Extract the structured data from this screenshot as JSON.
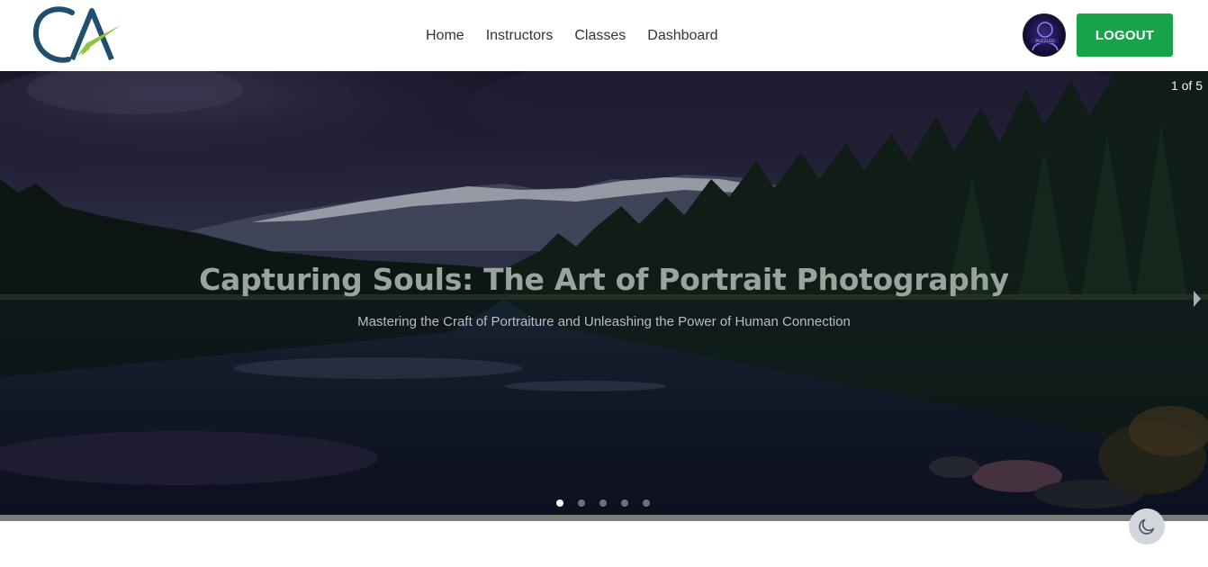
{
  "header": {
    "logo_text": "CA",
    "nav": [
      {
        "label": "Home"
      },
      {
        "label": "Instructors"
      },
      {
        "label": "Classes"
      },
      {
        "label": "Dashboard"
      }
    ],
    "logout_label": "LOGOUT",
    "avatar_text": "PUZZLED"
  },
  "hero": {
    "counter": "1 of 5",
    "title": "Capturing Souls: The Art of Portrait Photography",
    "subtitle": "Mastering the Craft of Portraiture and Unleashing the Power of Human Connection",
    "slides_total": 5,
    "active_slide": 1
  },
  "colors": {
    "logo_blue": "#1f4e6e",
    "logo_green": "#8cc63f",
    "logout_bg": "#16a34a",
    "nav_text": "#2f3437",
    "hero_title": "#9aa39c"
  },
  "icons": {
    "next": "chevron-right-icon",
    "theme": "moon-icon"
  }
}
